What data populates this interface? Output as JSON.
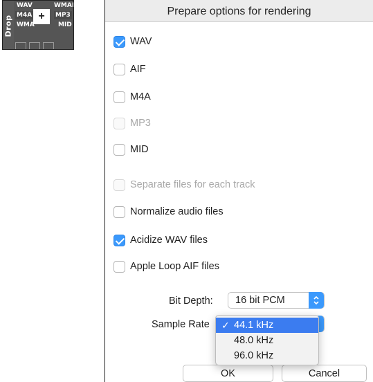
{
  "drop": {
    "tab_label": "Drop",
    "formats": [
      "WAV",
      "WMAL",
      "M4A",
      "MP3",
      "WMA",
      "MID"
    ],
    "plus": "+"
  },
  "dialog": {
    "title": "Prepare options for rendering",
    "options": [
      {
        "label": "WAV",
        "checked": true,
        "disabled": false
      },
      {
        "label": "AIF",
        "checked": false,
        "disabled": false
      },
      {
        "label": "M4A",
        "checked": false,
        "disabled": false
      },
      {
        "label": "MP3",
        "checked": false,
        "disabled": true
      },
      {
        "label": "MID",
        "checked": false,
        "disabled": false
      },
      {
        "label": "Separate files for each track",
        "checked": false,
        "disabled": true
      },
      {
        "label": "Normalize audio files",
        "checked": false,
        "disabled": false
      },
      {
        "label": "Acidize WAV files",
        "checked": true,
        "disabled": false
      },
      {
        "label": "Apple Loop AIF files",
        "checked": false,
        "disabled": false
      }
    ],
    "bit_depth": {
      "label": "Bit Depth:",
      "value": "16 bit PCM"
    },
    "sample_rate": {
      "label": "Sample Rate",
      "options": [
        "44.1 kHz",
        "48.0 kHz",
        "96.0 kHz"
      ],
      "selected": "44.1 kHz",
      "check_glyph": "✓"
    },
    "ok_label": "OK",
    "cancel_label": "Cancel"
  },
  "colors": {
    "accent": "#3b99fc",
    "menu_highlight": "#3b7cf0"
  }
}
